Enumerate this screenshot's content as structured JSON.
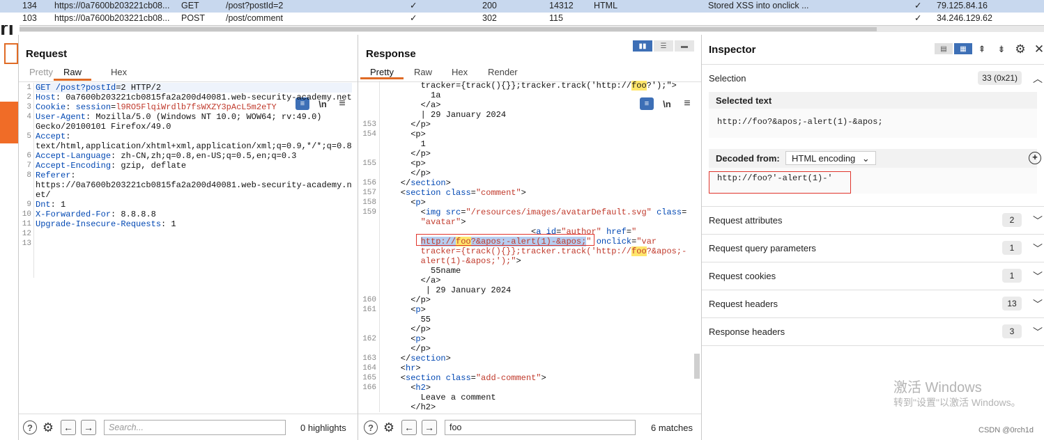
{
  "history": {
    "rows": [
      {
        "num": "134",
        "url": "https://0a7600b203221cb08...",
        "method": "GET",
        "path": "/post?postId=2",
        "edited": "✓",
        "status": "200",
        "length": "14312",
        "mime": "HTML",
        "title": "Stored XSS into onclick ...",
        "tls": "✓",
        "ip": "79.125.84.16",
        "selected": true
      },
      {
        "num": "103",
        "url": "https://0a7600b203221cb08...",
        "method": "POST",
        "path": "/post/comment",
        "edited": "✓",
        "status": "302",
        "length": "115",
        "mime": "",
        "title": "",
        "tls": "✓",
        "ip": "34.246.129.62",
        "selected": false
      }
    ]
  },
  "request": {
    "title": "Request",
    "tabs": [
      "Pretty",
      "Raw",
      "Hex"
    ],
    "active_tab": "Raw",
    "lines": [
      "1",
      "2",
      "3",
      "4",
      "",
      "5",
      "",
      "6",
      "7",
      "8",
      "",
      "",
      "9",
      "10",
      "11",
      "12",
      "13"
    ],
    "code": [
      [
        "GET /post?",
        "postId",
        "=2 HTTP/2"
      ],
      [
        "Host",
        ": 0a7600b203221cb0815fa2a200d40081.web-security-academy.net"
      ],
      [
        "Cookie",
        ": ",
        "session",
        "=",
        "l9RO5FlqiWrdlb7fsWXZY3pAcL5m2eTY"
      ],
      [
        "User-Agent",
        ": Mozilla/5.0 (Windows NT 10.0; WOW64; rv:49.0)"
      ],
      [
        "",
        "Gecko/20100101 Firefox/49.0"
      ],
      [
        "Accept",
        ":"
      ],
      [
        "",
        "text/html,application/xhtml+xml,application/xml;q=0.9,*/*;q=0.8"
      ],
      [
        "Accept-Language",
        ": zh-CN,zh;q=0.8,en-US;q=0.5,en;q=0.3"
      ],
      [
        "Accept-Encoding",
        ": gzip, deflate"
      ],
      [
        "Referer",
        ":"
      ],
      [
        "",
        "https://0a7600b203221cb0815fa2a200d40081.web-security-academy.n"
      ],
      [
        "",
        "et/"
      ],
      [
        "Dnt",
        ": 1"
      ],
      [
        "X-Forwarded-For",
        ": 8.8.8.8"
      ],
      [
        "Upgrade-Insecure-Requests",
        ": 1"
      ]
    ],
    "search_placeholder": "Search...",
    "highlights": "0 highlights"
  },
  "response": {
    "title": "Response",
    "tabs": [
      "Pretty",
      "Raw",
      "Hex",
      "Render"
    ],
    "active_tab": "Pretty",
    "gutter": [
      "",
      "",
      "",
      "",
      "153",
      "154",
      "",
      "",
      "155",
      "",
      "156",
      "157",
      "158",
      "159",
      "",
      "",
      "",
      "",
      "",
      "",
      "",
      "",
      "160",
      "161",
      "",
      "",
      "162",
      "",
      "163",
      "164",
      "165",
      "166",
      "",
      ""
    ],
    "search_value": "foo",
    "matches": "6 matches"
  },
  "inspector": {
    "title": "Inspector",
    "selection_label": "Selection",
    "selection_badge": "33 (0x21)",
    "selected_text_label": "Selected text",
    "selected_text": "http://foo?&apos;-alert(1)-&apos;",
    "decoded_from_label": "Decoded from:",
    "decoded_encoding": "HTML encoding",
    "decoded_text": "http://foo?'-alert(1)-'",
    "sections": [
      {
        "label": "Request attributes",
        "count": "2"
      },
      {
        "label": "Request query parameters",
        "count": "1"
      },
      {
        "label": "Request cookies",
        "count": "1"
      },
      {
        "label": "Request headers",
        "count": "13"
      },
      {
        "label": "Response headers",
        "count": "3"
      }
    ]
  },
  "watermark": {
    "line1": "激活 Windows",
    "line2": "转到\"设置\"以激活 Windows。",
    "credit": "CSDN @0rch1d"
  },
  "colors": {
    "accent": "#e06b25",
    "blue": "#3d6fb6",
    "highlight": "#ffe66b",
    "red_box": "#e0342b"
  }
}
